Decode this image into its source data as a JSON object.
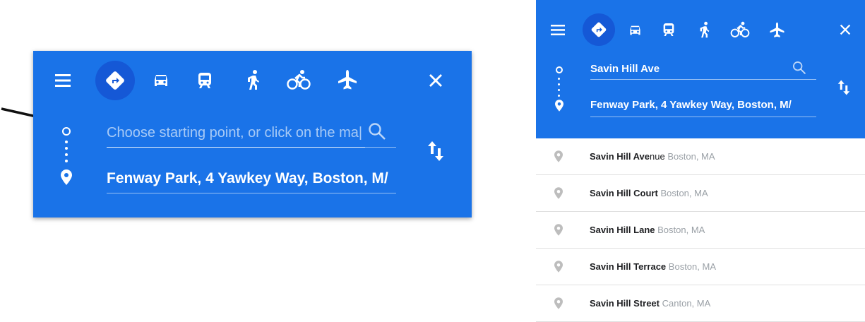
{
  "left_panel": {
    "start_placeholder": "Choose starting point, or click on the ma|",
    "destination_value": "Fenway Park, 4 Yawkey Way, Boston, M/"
  },
  "right_panel": {
    "start_value": "Savin Hill Ave",
    "destination_value": "Fenway Park, 4 Yawkey Way, Boston, M/"
  },
  "travel_modes": [
    "directions-icon",
    "car-icon",
    "transit-icon",
    "walk-icon",
    "bicycle-icon",
    "flight-icon"
  ],
  "suggestions": [
    {
      "match": "Savin Hill Ave",
      "rest": "nue",
      "rest_bold": false,
      "location": "Boston, MA"
    },
    {
      "match": "Savin Hill",
      "rest": " Court",
      "rest_bold": true,
      "location": "Boston, MA"
    },
    {
      "match": "Savin Hill",
      "rest": " Lane",
      "rest_bold": true,
      "location": "Boston, MA"
    },
    {
      "match": "Savin Hill",
      "rest": " Terrace",
      "rest_bold": true,
      "location": "Boston, MA"
    },
    {
      "match": "Savin Hill",
      "rest": " Street",
      "rest_bold": true,
      "location": "Canton, MA"
    }
  ],
  "colors": {
    "panel_blue": "#1a73e8",
    "active_mode_bg": "#1558d6"
  }
}
